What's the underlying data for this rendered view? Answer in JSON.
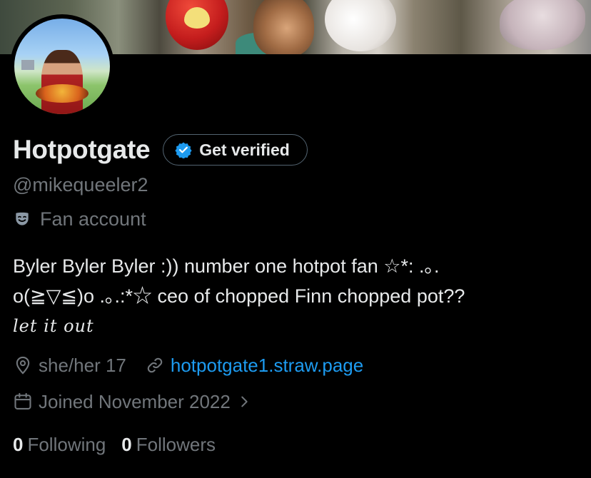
{
  "profile": {
    "display_name": "Hotpotgate",
    "handle": "@mikequeeler2",
    "category": "Fan account",
    "get_verified_label": "Get verified",
    "bio": {
      "line1": "Byler Byler Byler :)) number one hotpot fan ☆*: .｡.",
      "line2": "o(≧▽≦)o .｡.:*☆ ceo of chopped Finn chopped pot??",
      "line3": "let it out"
    },
    "location": "she/her 17",
    "website": "hotpotgate1.straw.page",
    "joined": "Joined November 2022",
    "following_count": "0",
    "following_label": "Following",
    "followers_count": "0",
    "followers_label": "Followers"
  },
  "colors": {
    "background": "#000000",
    "text_primary": "#e7e9ea",
    "text_secondary": "#71767b",
    "link": "#1d9bf0",
    "verified_badge": "#1d9bf0"
  },
  "icons": {
    "verified": "verified-badge-icon",
    "category": "theater-mask-icon",
    "location": "location-pin-icon",
    "link": "link-icon",
    "calendar": "calendar-icon",
    "chevron": "chevron-right-icon"
  }
}
